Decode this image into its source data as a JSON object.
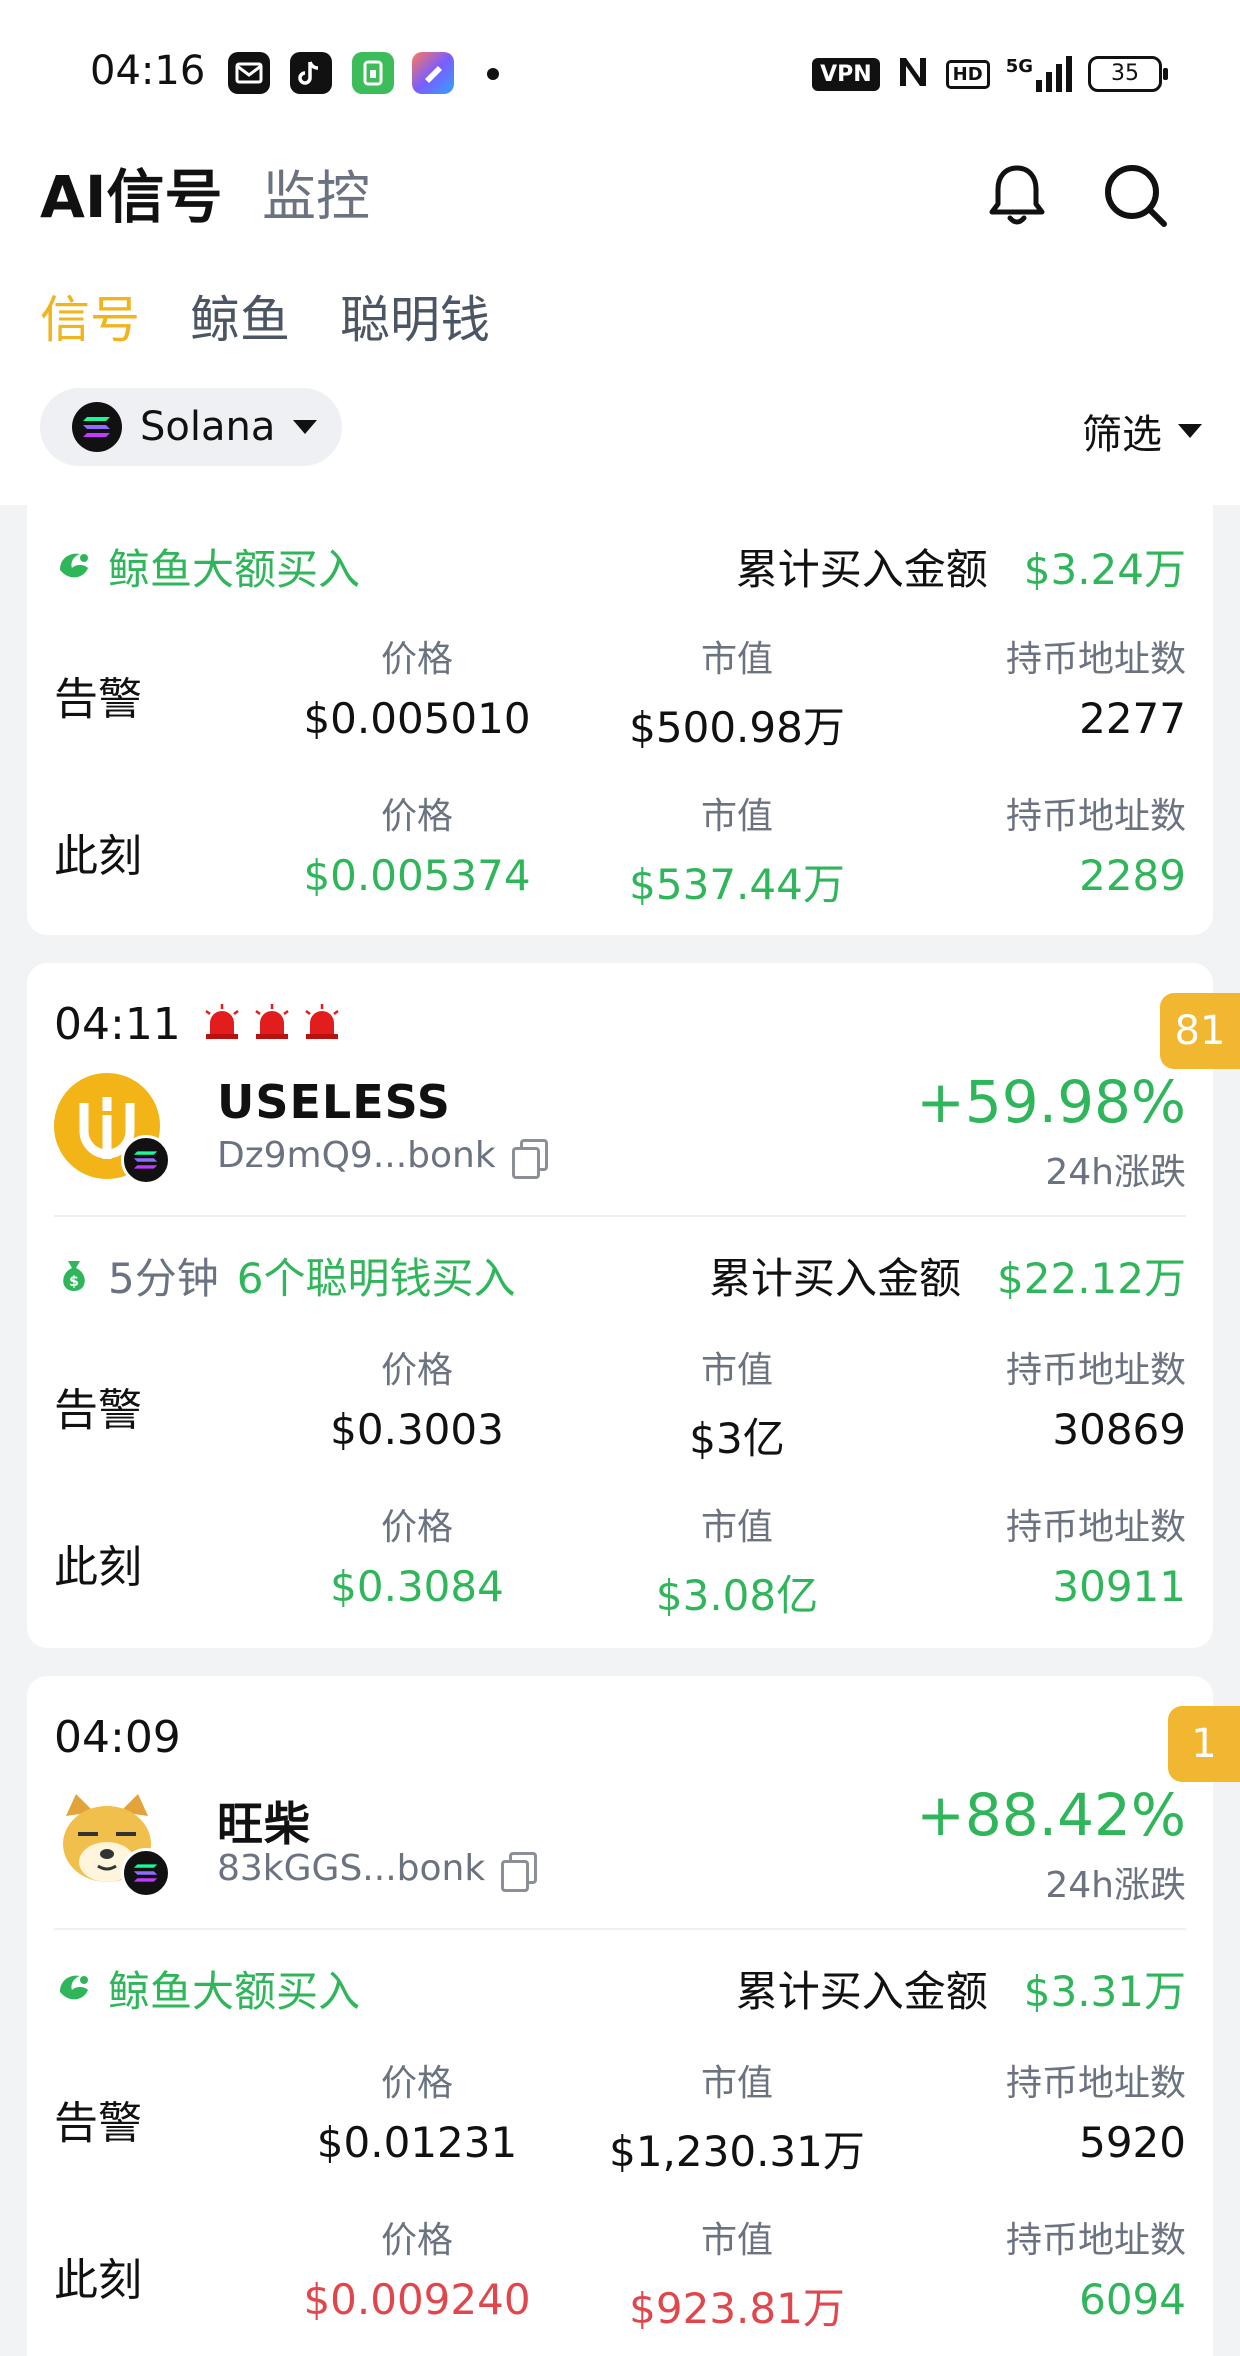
{
  "status_bar": {
    "time": "04:16",
    "vpn": "VPN",
    "hd": "HD",
    "network": "5G",
    "battery": "35"
  },
  "header": {
    "title": "AI信号",
    "subtitle": "监控",
    "tabs": [
      {
        "label": "信号",
        "active": true
      },
      {
        "label": "鲸鱼",
        "active": false
      },
      {
        "label": "聪明钱",
        "active": false
      }
    ],
    "chain": "Solana",
    "filter": "筛选"
  },
  "labels": {
    "alert": "告警",
    "now": "此刻",
    "price": "价格",
    "mcap": "市值",
    "holders": "持币地址数",
    "total_buy": "累计买入金额",
    "change_24h": "24h涨跌"
  },
  "cards": [
    {
      "signal": {
        "prefix": "",
        "tag": "鲸鱼大额买入",
        "total": "$3.24万"
      },
      "alert": {
        "price": "$0.005010",
        "mcap": "$500.98万",
        "holders": "2277"
      },
      "now": {
        "price": "$0.005374",
        "mcap": "$537.44万",
        "holders": "2289"
      }
    },
    {
      "time": "04:11",
      "rank": "81",
      "name": "USELESS",
      "address": "Dz9mQ9...bonk",
      "change": "+59.98%",
      "signal": {
        "prefix": "5分钟",
        "tag": "6个聪明钱买入",
        "total": "$22.12万"
      },
      "alert": {
        "price": "$0.3003",
        "mcap": "$3亿",
        "holders": "30869"
      },
      "now": {
        "price": "$0.3084",
        "mcap": "$3.08亿",
        "holders": "30911"
      }
    },
    {
      "time": "04:09",
      "rank": "1",
      "name": "旺柴",
      "address": "83kGGS...bonk",
      "change": "+88.42%",
      "signal": {
        "prefix": "",
        "tag": "鲸鱼大额买入",
        "total": "$3.31万"
      },
      "alert": {
        "price": "$0.01231",
        "mcap": "$1,230.31万",
        "holders": "5920"
      },
      "now": {
        "price": "$0.009240",
        "mcap": "$923.81万",
        "holders": "6094"
      }
    }
  ],
  "colors": {
    "accent": "#f0b41e",
    "up": "#2fb65a",
    "down": "#e0474c",
    "rank_badge": "#f2b731"
  },
  "icons": [
    "mail-icon",
    "tiktok-icon",
    "sim-icon",
    "app-icon",
    "bell-icon",
    "search-icon",
    "solana-icon",
    "whale-icon",
    "money-bag-icon",
    "siren-icon",
    "copy-icon"
  ]
}
